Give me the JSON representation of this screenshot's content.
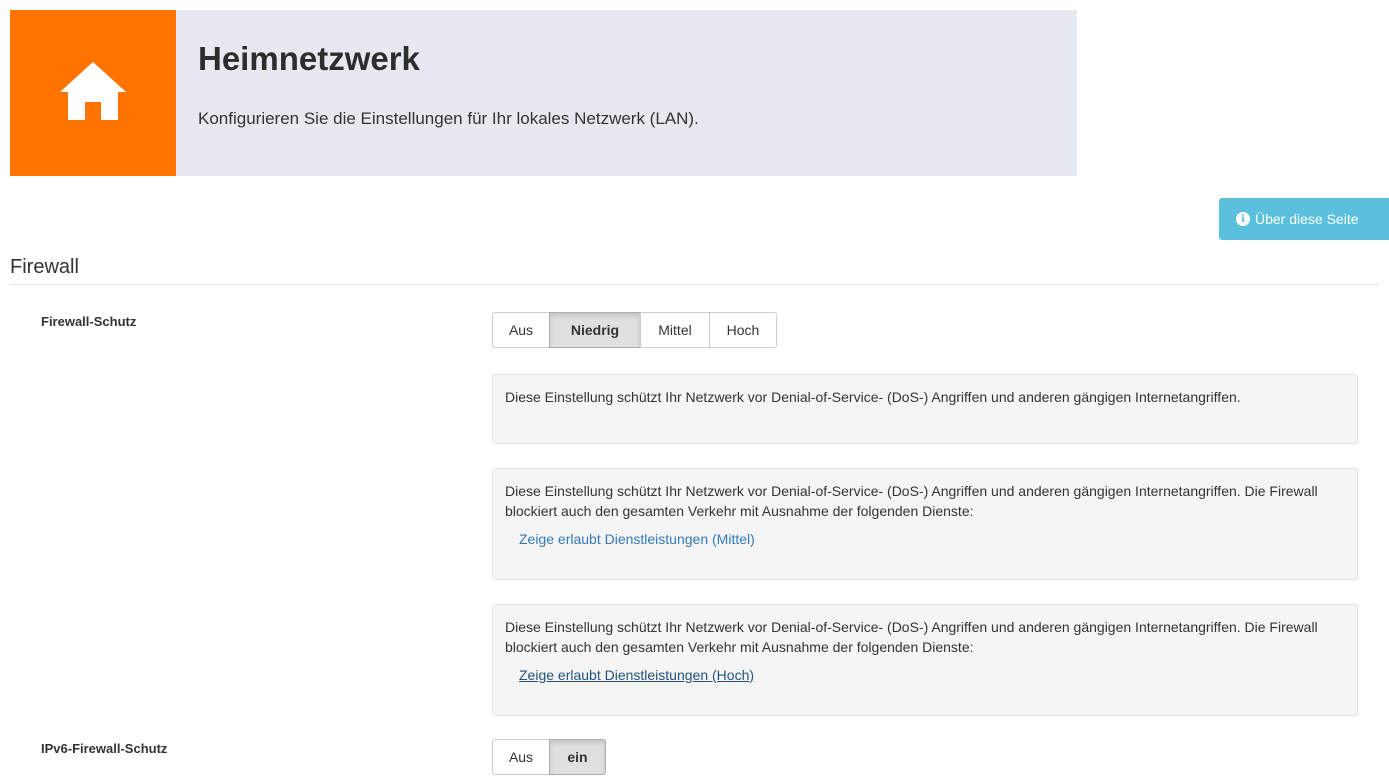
{
  "header": {
    "title": "Heimnetzwerk",
    "subtitle": "Konfigurieren Sie die Einstellungen für Ihr lokales Netzwerk (LAN).",
    "icon": "home-icon",
    "accent_color": "#ff7300",
    "background_color": "#e6e9f0"
  },
  "about_button": {
    "label": "Über diese Seite",
    "icon": "info-icon",
    "color": "#5bc0de"
  },
  "section": {
    "title": "Firewall"
  },
  "firewall": {
    "label": "Firewall-Schutz",
    "options": [
      "Aus",
      "Niedrig",
      "Mittel",
      "Hoch"
    ],
    "selected": "Niedrig",
    "descriptions": [
      {
        "text": "Diese Einstellung schützt Ihr Netzwerk vor Denial-of-Service- (DoS-) Angriffen und anderen gängigen Internetangriffen."
      },
      {
        "text": "Diese Einstellung schützt Ihr Netzwerk vor Denial-of-Service- (DoS-) Angriffen und anderen gängigen Internetangriffen. Die Firewall blockiert auch den gesamten Verkehr mit Ausnahme der folgenden Dienste:",
        "link": "Zeige erlaubt Dienstleistungen (Mittel)"
      },
      {
        "text": "Diese Einstellung schützt Ihr Netzwerk vor Denial-of-Service- (DoS-) Angriffen und anderen gängigen Internetangriffen. Die Firewall blockiert auch den gesamten Verkehr mit Ausnahme der folgenden Dienste:",
        "link": "Zeige erlaubt Dienstleistungen (Hoch)"
      }
    ]
  },
  "ipv6_firewall": {
    "label": "IPv6-Firewall-Schutz",
    "options": [
      "Aus",
      "ein"
    ],
    "selected": "ein"
  }
}
